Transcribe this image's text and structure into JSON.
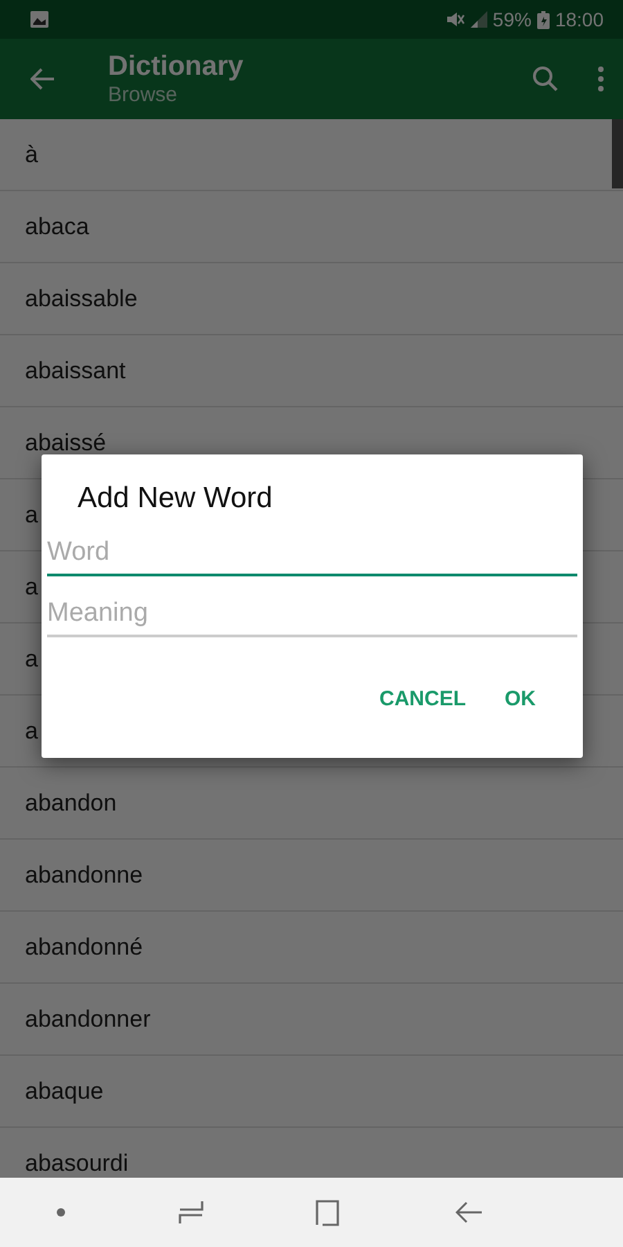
{
  "status_bar": {
    "battery": "59%",
    "time": "18:00"
  },
  "app_bar": {
    "title": "Dictionary",
    "subtitle": "Browse"
  },
  "words": [
    "à",
    "abaca",
    "abaissable",
    "abaissant",
    "abaissé",
    "a",
    "a",
    "a",
    "a",
    "abandon",
    "abandonne",
    "abandonné",
    "abandonner",
    "abaque",
    "abasourdi"
  ],
  "dialog": {
    "title": "Add New Word",
    "fields": [
      {
        "placeholder": "Word",
        "focused": true
      },
      {
        "placeholder": "Meaning",
        "focused": false
      }
    ],
    "buttons": [
      "CANCEL",
      "OK"
    ]
  }
}
